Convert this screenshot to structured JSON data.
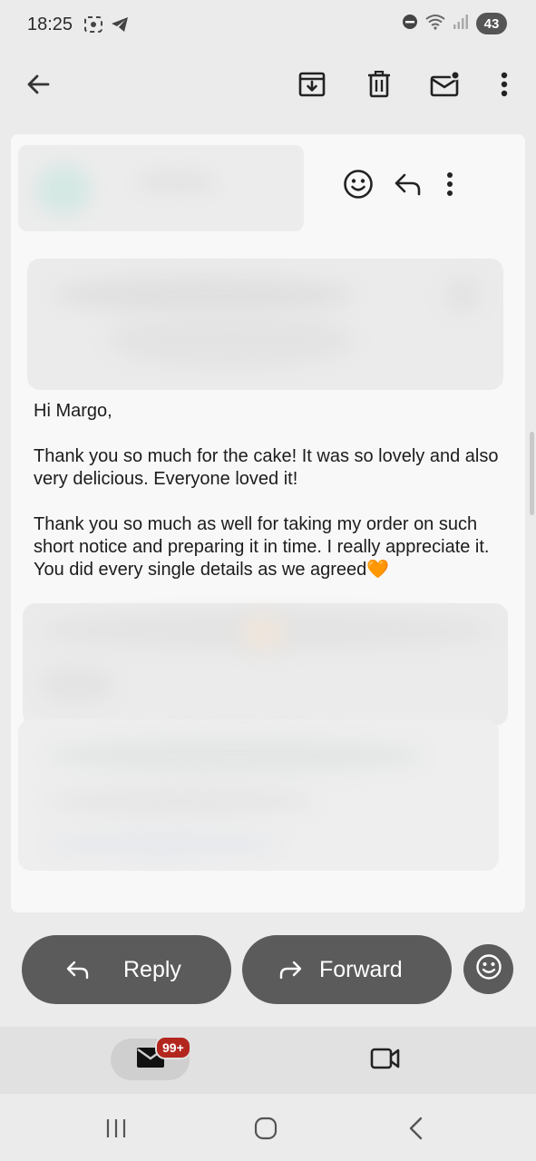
{
  "status_bar": {
    "time": "18:25",
    "battery": "43",
    "icons": [
      "screenshot-icon",
      "telegram-icon",
      "dnd-icon",
      "wifi-icon",
      "signal-icon"
    ]
  },
  "toolbar": {
    "icons": [
      "back-arrow-icon",
      "archive-icon",
      "delete-icon",
      "mark-unread-icon",
      "more-vert-icon"
    ]
  },
  "message": {
    "greeting": "Hi Margo,",
    "paragraph_1": "Thank you so much for the cake! It was so lovely and also very delicious. Everyone loved it!",
    "paragraph_2": "Thank you so much as well for taking my order on such short notice and preparing it in time. I really appreciate it. You did every single details as we agreed",
    "heart_emoji": "🧡"
  },
  "actions": {
    "reply_label": "Reply",
    "forward_label": "Forward"
  },
  "bottom_nav": {
    "mail_badge": "99+"
  },
  "colors": {
    "pill_bg": "#5b5b5b",
    "badge_bg": "#b3261e",
    "heart": "#f29a1c"
  }
}
